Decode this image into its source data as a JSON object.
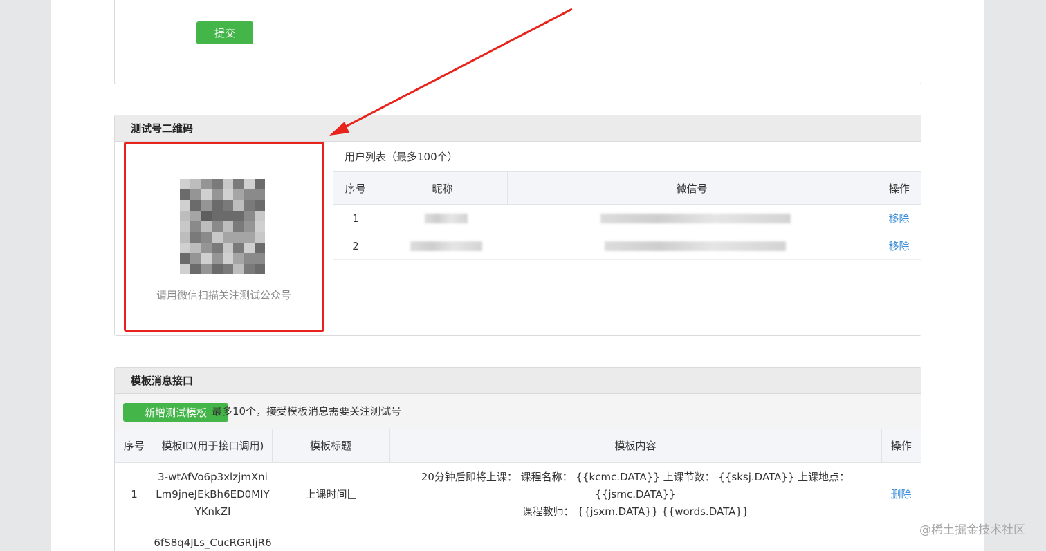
{
  "top_panel": {
    "submit_label": "提交"
  },
  "qr_panel": {
    "title": "测试号二维码",
    "qr_caption": "请用微信扫描关注测试公众号",
    "users_title": "用户列表（最多100个）",
    "columns": [
      "序号",
      "昵称",
      "微信号",
      "操作"
    ],
    "rows": [
      {
        "index": "1",
        "action": "移除"
      },
      {
        "index": "2",
        "action": "移除"
      }
    ]
  },
  "template_panel": {
    "title": "模板消息接口",
    "add_label": "新增测试模板",
    "hint": "最多10个，接受模板消息需要关注测试号",
    "columns": [
      "序号",
      "模板ID(用于接口调用)",
      "模板标题",
      "模板内容",
      "操作"
    ],
    "rows": [
      {
        "index": "1",
        "id_line1": "3-wtAfVo6p3xlzjmXni",
        "id_line2": "Lm9jneJEkBh6ED0MIY",
        "id_line3": "YKnkZI",
        "title": "上课时间",
        "content_line1": "20分钟后即将上课： 课程名称： {{kcmc.DATA}} 上课节数： {{sksj.DATA}} 上课地点： {{jsmc.DATA}}",
        "content_line2": "课程教师： {{jsxm.DATA}} {{words.DATA}}",
        "action": "删除"
      },
      {
        "index": "",
        "id_line1": "6fS8q4JLs_CucRGRIjR6"
      }
    ]
  },
  "watermark": "@稀土掘金技术社区",
  "colors": {
    "accent_green": "#44b549",
    "link_blue": "#3e8fd8",
    "annotation_red": "#e8231c"
  }
}
